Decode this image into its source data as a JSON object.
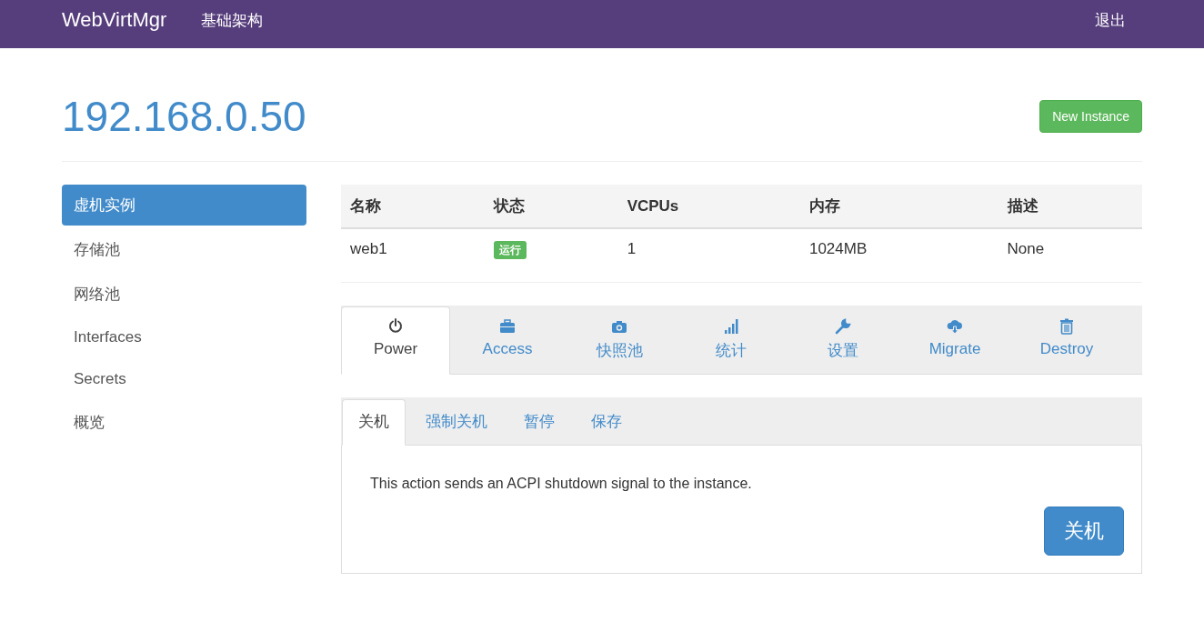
{
  "navbar": {
    "brand": "WebVirtMgr",
    "links": [
      {
        "label": "基础架构"
      }
    ],
    "logout": "退出"
  },
  "page": {
    "title": "192.168.0.50",
    "new_button": "New Instance"
  },
  "sidebar": {
    "items": [
      {
        "label": "虚机实例",
        "selected": true
      },
      {
        "label": "存储池",
        "selected": false
      },
      {
        "label": "网络池",
        "selected": false
      },
      {
        "label": "Interfaces",
        "selected": false
      },
      {
        "label": "Secrets",
        "selected": false
      },
      {
        "label": "概览",
        "selected": false
      }
    ]
  },
  "table": {
    "columns": [
      "名称",
      "状态",
      "VCPUs",
      "内存",
      "描述"
    ],
    "rows": [
      {
        "name": "web1",
        "status": "运行",
        "vcpus": "1",
        "memory": "1024MB",
        "description": "None"
      }
    ]
  },
  "action_tabs": [
    {
      "label": "Power",
      "selected": true
    },
    {
      "label": "Access",
      "selected": false
    },
    {
      "label": "快照池",
      "selected": false
    },
    {
      "label": "统计",
      "selected": false
    },
    {
      "label": "设置",
      "selected": false
    },
    {
      "label": "Migrate",
      "selected": false
    },
    {
      "label": "Destroy",
      "selected": false
    }
  ],
  "power_tabs": [
    {
      "label": "关机",
      "selected": true
    },
    {
      "label": "强制关机",
      "selected": false
    },
    {
      "label": "暂停",
      "selected": false
    },
    {
      "label": "保存",
      "selected": false
    }
  ],
  "panel": {
    "text": "This action sends an ACPI shutdown signal to the instance.",
    "button": "关机"
  }
}
